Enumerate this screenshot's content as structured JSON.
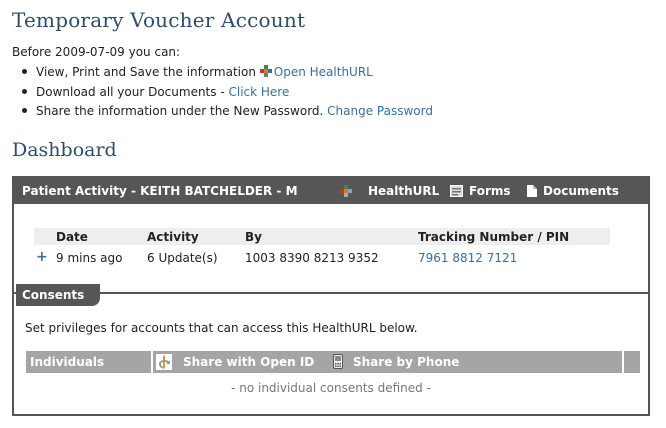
{
  "page_title": "Temporary Voucher Account",
  "intro": "Before 2009-07-09 you can:",
  "bullets": [
    {
      "text": "View, Print and Save the information",
      "link": "Open HealthURL"
    },
    {
      "text": "Download all your Documents - ",
      "link": "Click Here"
    },
    {
      "text": "Share the information under the New Password. ",
      "link": "Change Password"
    }
  ],
  "dashboard_title": "Dashboard",
  "panel": {
    "title": "Patient Activity - KEITH BATCHELDER - M",
    "nav": {
      "healthurl": "HealthURL",
      "forms": "Forms",
      "documents": "Documents"
    }
  },
  "activity": {
    "columns": [
      "Date",
      "Activity",
      "By",
      "Tracking Number / PIN"
    ],
    "rows": [
      {
        "expand": "+",
        "date": "9 mins ago",
        "activity": "6 Update(s)",
        "by": "1003 8390 8213 9352",
        "tracking": "7961 8812 7121"
      }
    ]
  },
  "consents": {
    "tab": "Consents",
    "text": "Set privileges for accounts that can access this HealthURL below.",
    "columns": {
      "individuals": "Individuals",
      "openid": "Share with Open ID",
      "phone": "Share by Phone"
    },
    "empty": "- no individual consents defined -"
  },
  "colors": {
    "heading": "#2e4d6b",
    "link": "#3a6e9e",
    "panel": "#565656",
    "table_head": "#a5a5a5"
  }
}
